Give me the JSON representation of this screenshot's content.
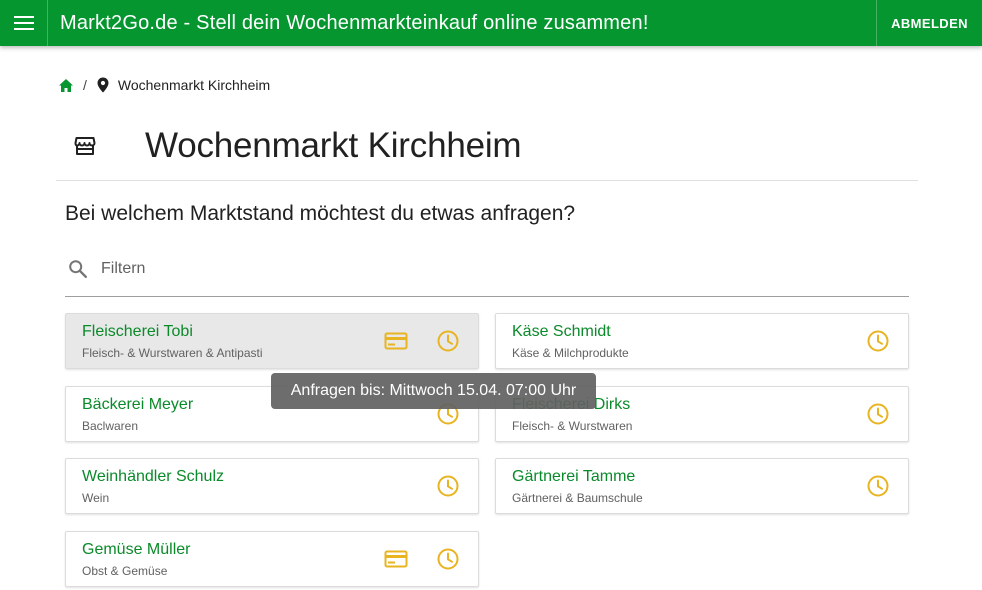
{
  "header": {
    "title": "Markt2Go.de - Stell dein Wochenmarkteinkauf online zusammen!",
    "logout_label": "ABMELDEN"
  },
  "breadcrumb": {
    "separator": "/",
    "market": "Wochenmarkt Kirchheim"
  },
  "page": {
    "title": "Wochenmarkt Kirchheim",
    "question": "Bei welchem Marktstand möchtest du etwas anfragen?"
  },
  "filter": {
    "placeholder": "Filtern",
    "value": ""
  },
  "stands": [
    {
      "name": "Fleischerei Tobi",
      "category": "Fleisch- & Wurstwaren & Antipasti",
      "card_payment": true
    },
    {
      "name": "Käse Schmidt",
      "category": "Käse & Milchprodukte",
      "card_payment": false
    },
    {
      "name": "Bäckerei Meyer",
      "category": "Baclwaren",
      "card_payment": false
    },
    {
      "name": "Fleischerei Dirks",
      "category": "Fleisch- & Wurstwaren",
      "card_payment": false
    },
    {
      "name": "Weinhändler Schulz",
      "category": "Wein",
      "card_payment": false
    },
    {
      "name": "Gärtnerei Tamme",
      "category": "Gärtnerei & Baumschule",
      "card_payment": false
    },
    {
      "name": "Gemüse Müller",
      "category": "Obst & Gemüse",
      "card_payment": true
    }
  ],
  "tooltip": {
    "text": "Anfragen bis: Mittwoch 15.04. 07:00 Uhr"
  },
  "icons": {
    "menu": "menu-icon",
    "home": "home-icon",
    "location": "location-pin-icon",
    "store": "storefront-icon",
    "search": "search-icon",
    "card": "credit-card-icon",
    "clock": "clock-icon"
  },
  "colors": {
    "brand_green": "#06962f",
    "stand_name_green": "#0a8a2a",
    "icon_yellow": "#e8b422",
    "tooltip_bg": "#616161"
  }
}
